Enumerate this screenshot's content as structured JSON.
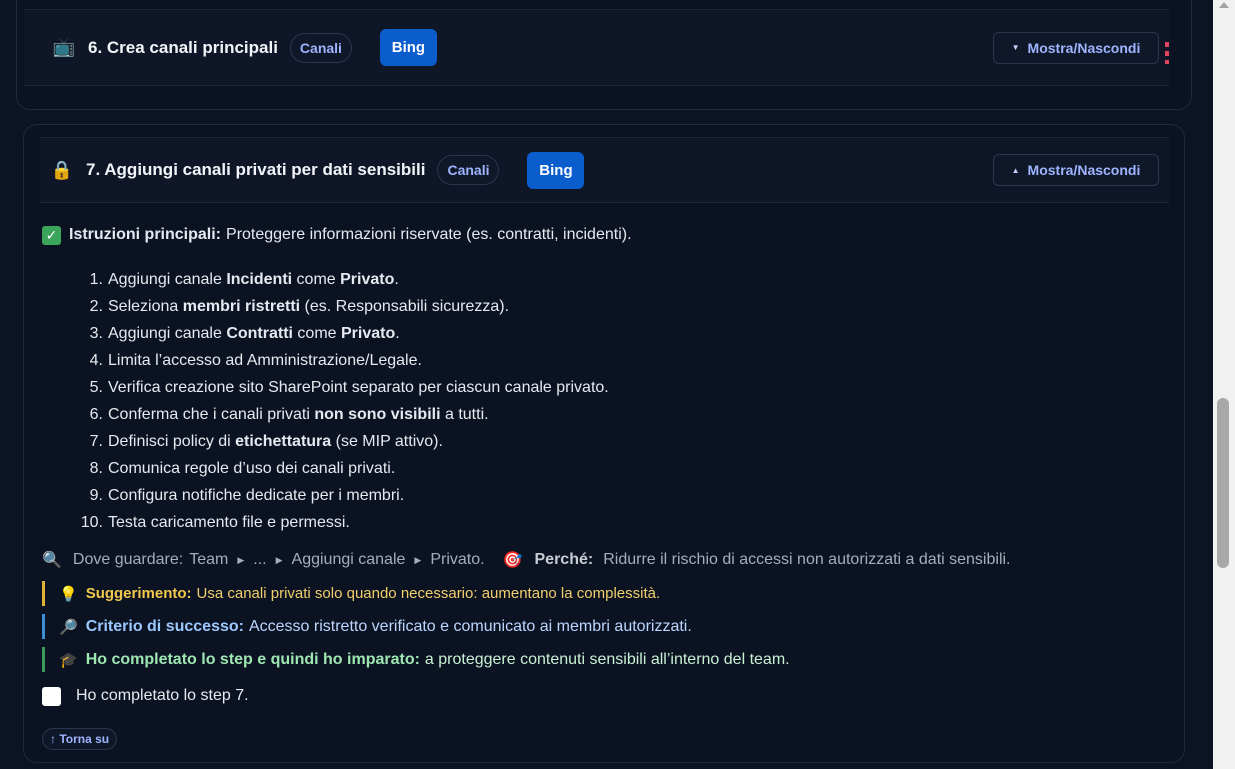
{
  "step6": {
    "icon": "📺",
    "title": "6. Crea canali principali",
    "pill": "Canali",
    "bing": "Bing",
    "toggle": "Mostra/Nascondi"
  },
  "step7": {
    "icon": "🔒",
    "title": "7. Aggiungi canali privati per dati sensibili",
    "pill": "Canali",
    "bing": "Bing",
    "toggle": "Mostra/Nascondi",
    "intro_label": "Istruzioni principali:",
    "intro_text": "Proteggere informazioni riservate (es. contratti, incidenti).",
    "steps": [
      {
        "num": "1.",
        "parts": [
          "Aggiungi canale ",
          "Incidenti",
          " come ",
          "Privato",
          "."
        ]
      },
      {
        "num": "2.",
        "parts": [
          "Seleziona ",
          "membri ristretti",
          " (es. Responsabili sicurezza)."
        ]
      },
      {
        "num": "3.",
        "parts": [
          "Aggiungi canale ",
          "Contratti",
          " come ",
          "Privato",
          "."
        ]
      },
      {
        "num": "4.",
        "parts": [
          "Limita l’accesso ad Amministrazione/Legale."
        ]
      },
      {
        "num": "5.",
        "parts": [
          "Verifica creazione sito SharePoint separato per ciascun canale privato."
        ]
      },
      {
        "num": "6.",
        "parts": [
          "Conferma che i canali privati ",
          "non sono visibili",
          " a tutti."
        ]
      },
      {
        "num": "7.",
        "parts": [
          "Definisci policy di ",
          "etichettatura",
          " (se MIP attivo)."
        ]
      },
      {
        "num": "8.",
        "parts": [
          "Comunica regole d’uso dei canali privati."
        ]
      },
      {
        "num": "9.",
        "parts": [
          "Configura notifiche dedicate per i membri."
        ]
      },
      {
        "num": "10.",
        "parts": [
          "Testa caricamento file e permessi."
        ]
      }
    ],
    "where_label": "Dove guardare:",
    "path": [
      "Team",
      "...",
      "Aggiungi canale",
      "Privato."
    ],
    "why_label": "Perché:",
    "why_text": "Ridurre il rischio di accessi non autorizzati a dati sensibili.",
    "tip_label": "Suggerimento:",
    "tip_text": "Usa canali privati solo quando necessario: aumentano la complessità.",
    "success_label": "Criterio di successo:",
    "success_text": "Accesso ristretto verificato e comunicato ai membri autorizzati.",
    "learn_label": "Ho completato lo step e quindi ho imparato:",
    "learn_text": "a proteggere contenuti sensibili all’interno del team.",
    "done_label": "Ho completato lo step 7.",
    "back": "↑ Torna su"
  },
  "icons": {
    "search": "🔍",
    "target": "🎯",
    "bulb": "💡",
    "magnifier": "🔎",
    "graduation": "🎓",
    "check": "✓"
  }
}
